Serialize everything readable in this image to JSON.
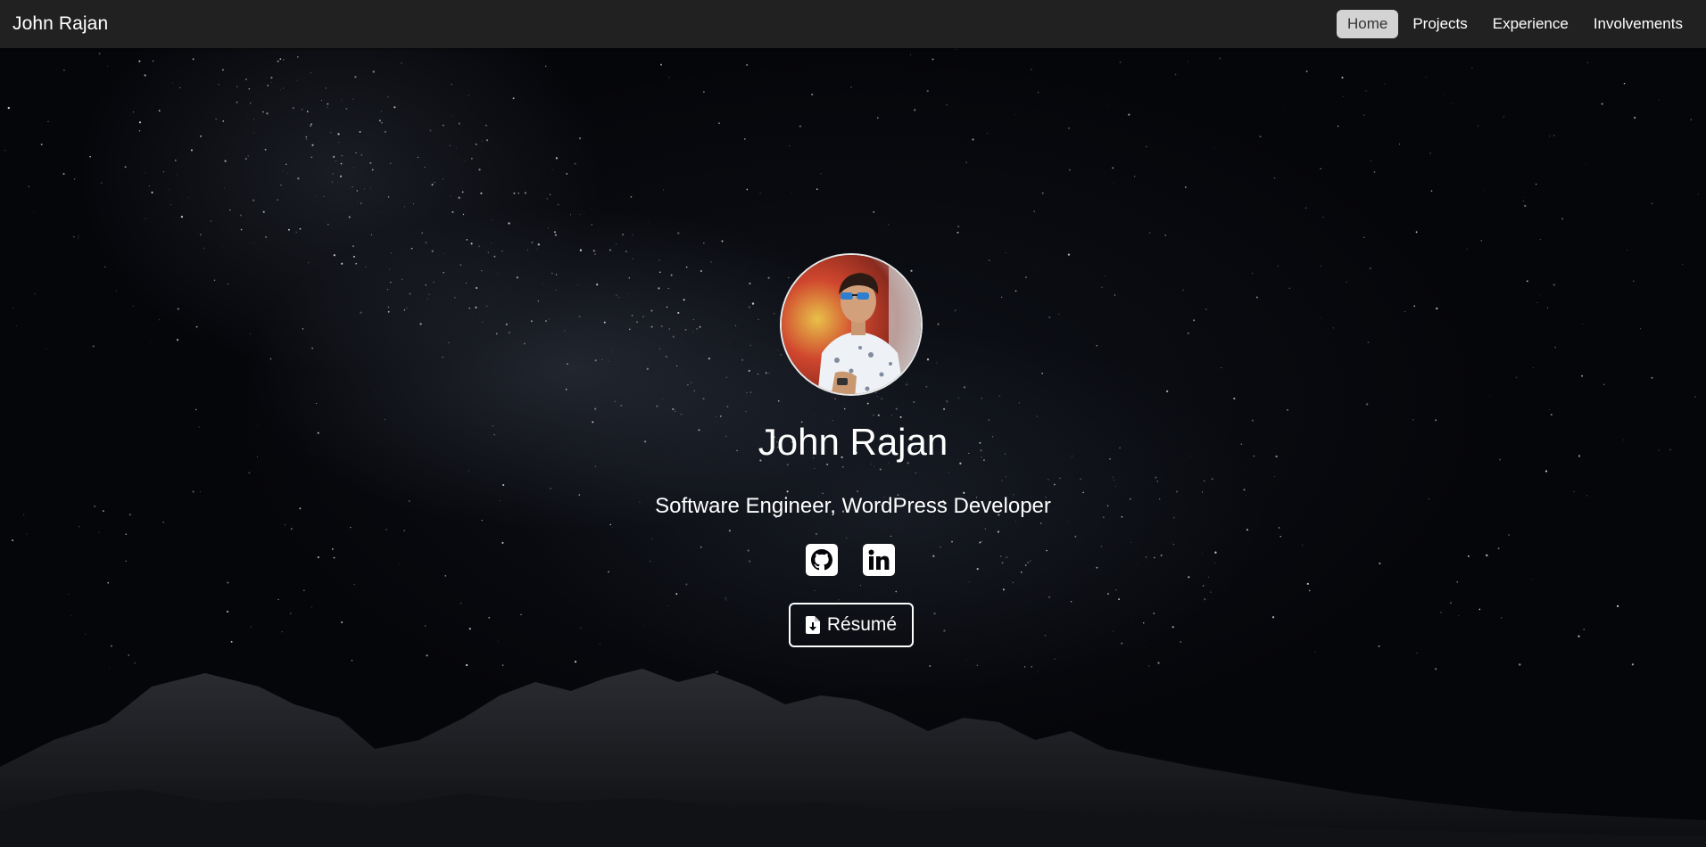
{
  "navbar": {
    "brand": "John Rajan",
    "links": [
      {
        "label": "Home",
        "active": true
      },
      {
        "label": "Projects",
        "active": false
      },
      {
        "label": "Experience",
        "active": false
      },
      {
        "label": "Involvements",
        "active": false
      }
    ]
  },
  "hero": {
    "name": "John Rajan",
    "tagline": "Software Engineer, WordPress Developer",
    "social": [
      {
        "icon": "github-icon"
      },
      {
        "icon": "linkedin-icon"
      }
    ],
    "resume_button": {
      "label": "Résumé",
      "icon": "file-download-icon"
    }
  },
  "colors": {
    "navbar_bg": "#212121",
    "active_link_bg": "#d3d3d3",
    "hero_bg": "#05060a",
    "text": "#ffffff"
  }
}
